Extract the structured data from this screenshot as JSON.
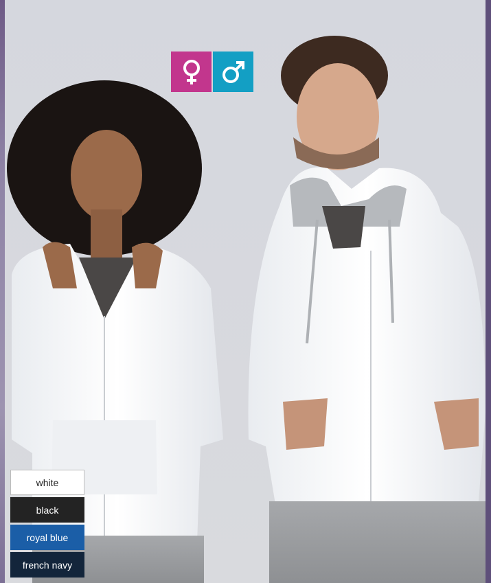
{
  "gender_icons": [
    "female-symbol-icon",
    "male-symbol-icon"
  ],
  "colors": {
    "female_badge": "#c2368d",
    "male_badge": "#139fc4"
  },
  "swatches": [
    {
      "label": "white",
      "color": "#ffffff"
    },
    {
      "label": "black",
      "color": "#232323"
    },
    {
      "label": "royal blue",
      "color": "#1b5ea7"
    },
    {
      "label": "french navy",
      "color": "#13253b"
    }
  ]
}
